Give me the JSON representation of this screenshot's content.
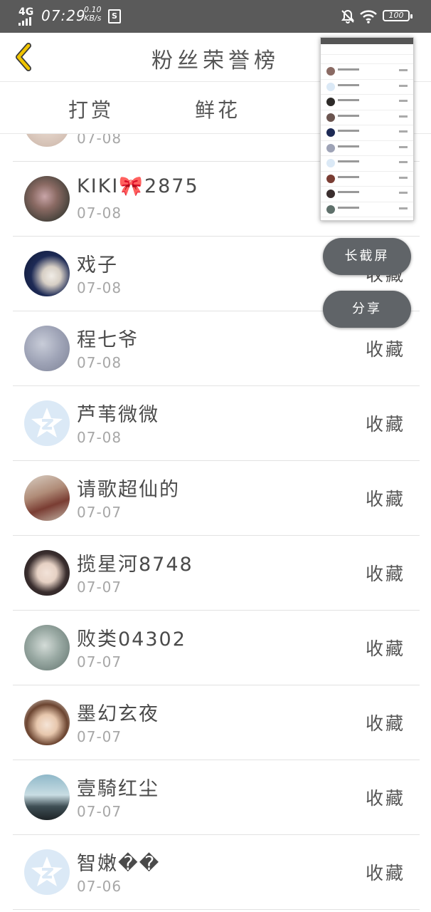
{
  "status_bar": {
    "network": "4G",
    "time": "07:29",
    "speed_value": "0.10",
    "speed_unit": "KB/s",
    "app_icon_letter": "S",
    "battery": "100",
    "icons": [
      "signal-icon",
      "bell-off-icon",
      "wifi-icon",
      "battery-icon"
    ]
  },
  "header": {
    "title": "粉丝荣誉榜",
    "back_icon": "chevron-left-icon"
  },
  "tabs": [
    {
      "label": "打赏"
    },
    {
      "label": "鲜花"
    }
  ],
  "list": [
    {
      "name": "",
      "date": "07-08",
      "fav": ""
    },
    {
      "name": "KIKI🎀2875",
      "date": "07-08",
      "fav": ""
    },
    {
      "name": "戏子",
      "date": "07-08",
      "fav": "收藏"
    },
    {
      "name": "程七爷",
      "date": "07-08",
      "fav": "收藏"
    },
    {
      "name": "芦苇微微",
      "date": "07-08",
      "fav": "收藏"
    },
    {
      "name": "请歌超仙的",
      "date": "07-07",
      "fav": "收藏"
    },
    {
      "name": "揽星河8748",
      "date": "07-07",
      "fav": "收藏"
    },
    {
      "name": "败类04302",
      "date": "07-07",
      "fav": "收藏"
    },
    {
      "name": "墨幻玄夜",
      "date": "07-07",
      "fav": "收藏"
    },
    {
      "name": "壹騎红尘",
      "date": "07-07",
      "fav": "收藏"
    },
    {
      "name": "智嫩��",
      "date": "07-06",
      "fav": "收藏"
    }
  ],
  "float_buttons": {
    "long_screenshot": "长截屏",
    "share": "分享"
  },
  "colors": {
    "status_bar": "#5a5a5a",
    "back_arrow": "#e0b000",
    "float_button": "#606468",
    "default_avatar": "#dbe9f6"
  }
}
